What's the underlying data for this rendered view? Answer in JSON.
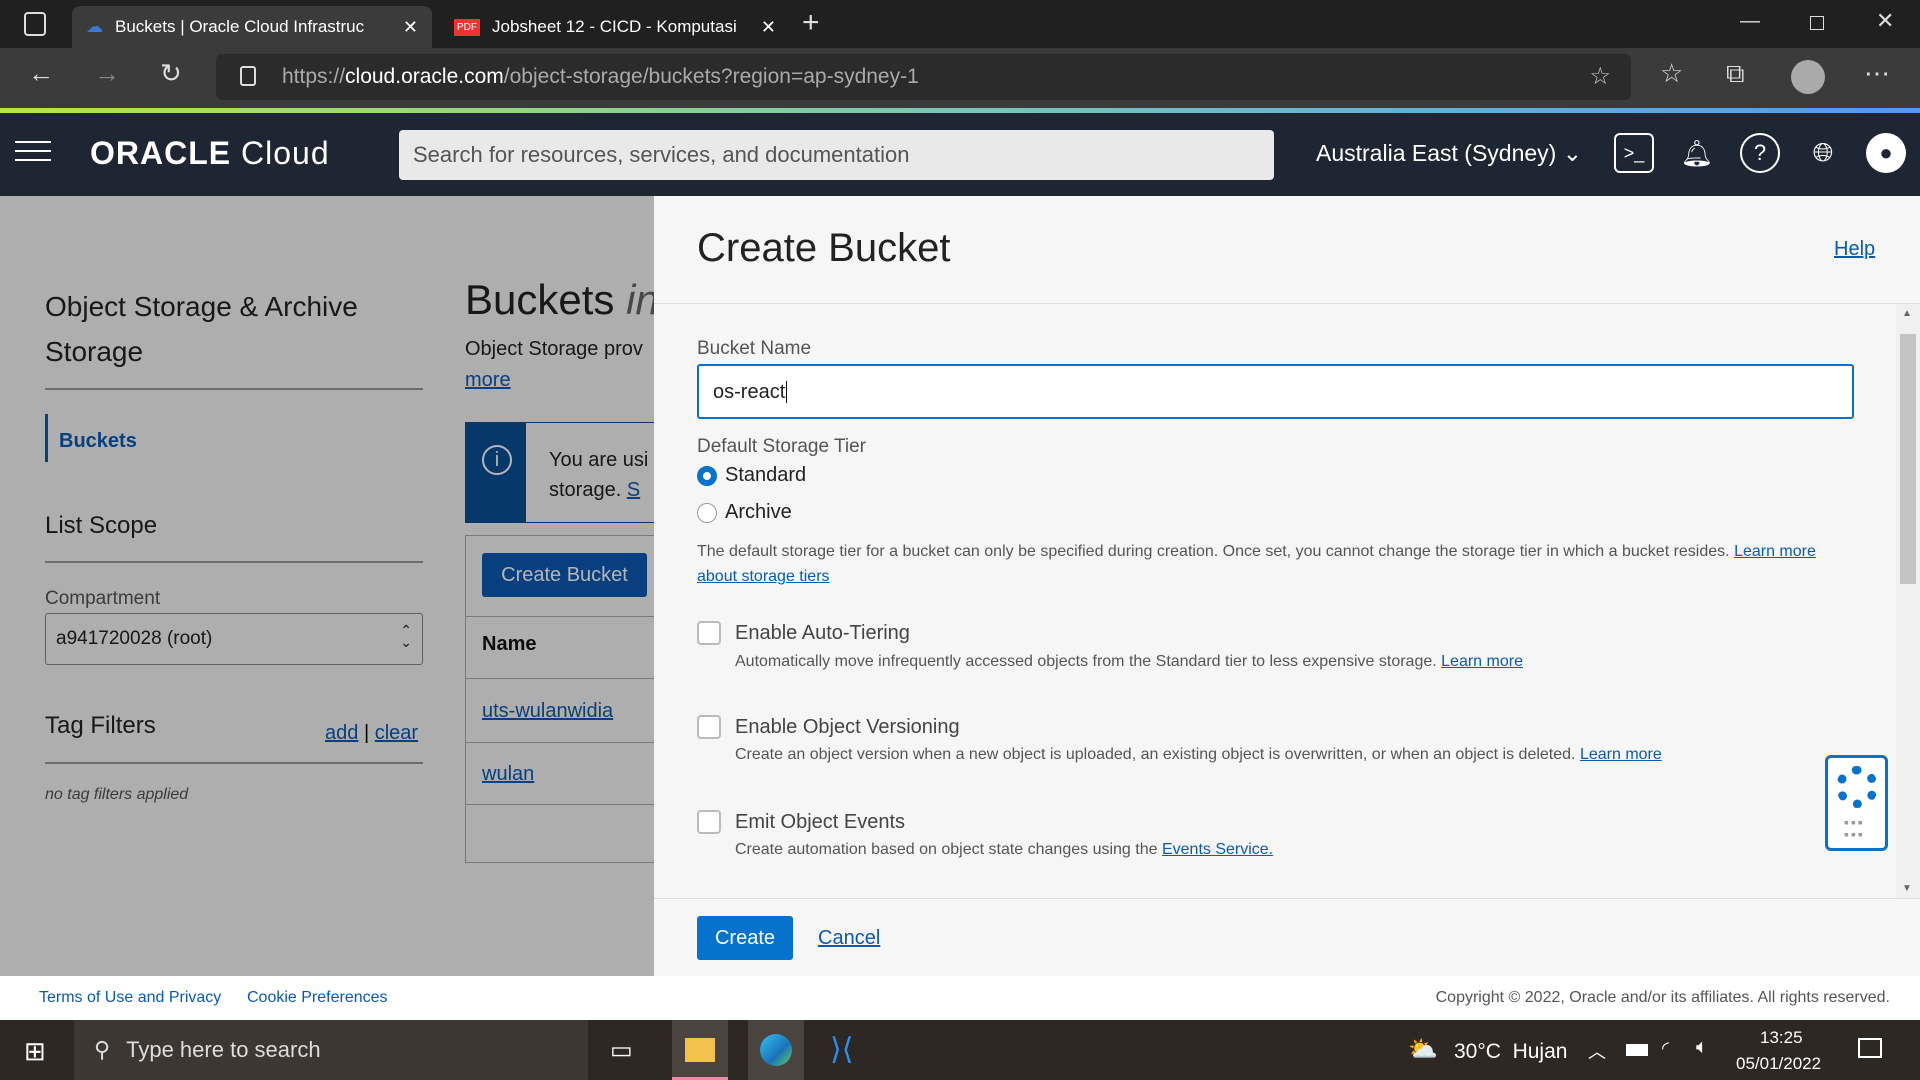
{
  "browser": {
    "tabs": [
      {
        "title": "Buckets | Oracle Cloud Infrastruc"
      },
      {
        "title": "Jobsheet 12 - CICD - Komputasi "
      }
    ],
    "url_prefix": "https://",
    "url_domain": "cloud.oracle.com",
    "url_path": "/object-storage/buckets?region=ap-sydney-1"
  },
  "header": {
    "logo": "ORACLE",
    "logo_sub": "Cloud",
    "search_placeholder": "Search for resources, services, and documentation",
    "region": "Australia East (Sydney)"
  },
  "sidebar": {
    "title": "Object Storage & Archive Storage",
    "nav": [
      {
        "label": "Buckets"
      }
    ],
    "list_scope": "List Scope",
    "compartment_label": "Compartment",
    "compartment_value": "a941720028 (root)",
    "tag_filters": "Tag Filters",
    "add": "add",
    "sep": "|",
    "clear": "clear",
    "no_tags": "no tag filters applied"
  },
  "main": {
    "title": "Buckets",
    "title_suffix": "in",
    "desc": "Object Storage prov",
    "more": "more",
    "info_line1": "You are usi",
    "info_line2": "storage.",
    "info_link": "S",
    "create_button": "Create Bucket",
    "col_name": "Name",
    "rows": [
      "uts-wulanwidia",
      "wulan"
    ]
  },
  "drawer": {
    "title": "Create Bucket",
    "help": "Help",
    "bucket_name_label": "Bucket Name",
    "bucket_name_value": "os-react",
    "tier_label": "Default Storage Tier",
    "tiers": [
      {
        "label": "Standard",
        "selected": true
      },
      {
        "label": "Archive",
        "selected": false
      }
    ],
    "tier_help": "The default storage tier for a bucket can only be specified during creation. Once set, you cannot change the storage tier in which a bucket resides.",
    "tier_link": "Learn more about storage tiers",
    "options": [
      {
        "label": "Enable Auto-Tiering",
        "desc": "Automatically move infrequently accessed objects from the Standard tier to less expensive storage.",
        "link": "Learn more",
        "checked": false
      },
      {
        "label": "Enable Object Versioning",
        "desc": "Create an object version when a new object is uploaded, an existing object is overwritten, or when an object is deleted.",
        "link": "Learn more",
        "checked": false
      },
      {
        "label": "Emit Object Events",
        "desc": "Create automation based on object state changes using the",
        "link": "Events Service.",
        "checked": false
      }
    ],
    "create": "Create",
    "cancel": "Cancel"
  },
  "footer": {
    "terms": "Terms of Use and Privacy",
    "cookies": "Cookie Preferences",
    "copyright": "Copyright © 2022, Oracle and/or its affiliates. All rights reserved."
  },
  "taskbar": {
    "search": "Type here to search",
    "weather": "30°C  Hujan",
    "time": "13:25",
    "date": "05/01/2022"
  },
  "colors": {
    "accent": "#0572ce",
    "header_bg": "#1e2634",
    "link": "#0a5ab3"
  }
}
